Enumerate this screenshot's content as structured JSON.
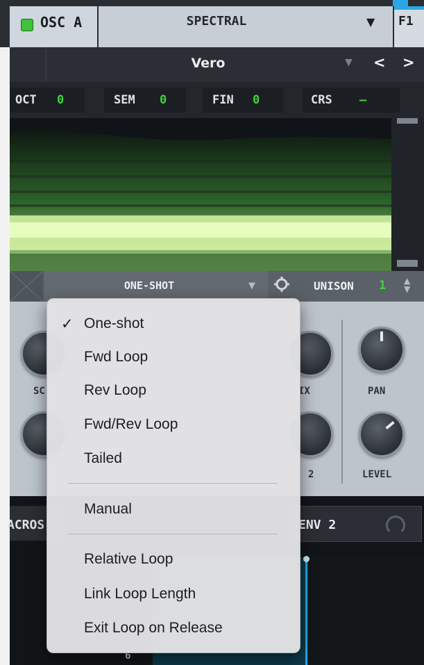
{
  "header": {
    "osc_label": "OSC A",
    "mode_value": "SPECTRAL",
    "mode_arrow": "▼",
    "filter_tab": "F1"
  },
  "wavetable": {
    "name": "Vero",
    "dropdown_arrow": "▼",
    "prev": "<",
    "next": ">"
  },
  "tuning": [
    {
      "label": "OCT",
      "value": "0"
    },
    {
      "label": "SEM",
      "value": "0"
    },
    {
      "label": "FIN",
      "value": "0"
    },
    {
      "label": "CRS",
      "value": "–"
    }
  ],
  "loop_mode": {
    "value": "ONE-SHOT",
    "arrow": "▼"
  },
  "unison": {
    "label": "UNISON",
    "value": "1",
    "stepper": "▲▼"
  },
  "knobs": {
    "sc_label": "SC",
    "ix_label": "IX",
    "pan_label": "PAN",
    "v2_label": "2",
    "level_label": "LEVEL"
  },
  "lower": {
    "macro_label": "ACROS",
    "env_label": "ENV 2",
    "env_marker": "6"
  },
  "menu": {
    "check": "✓",
    "items": [
      "One-shot",
      "Fwd Loop",
      "Rev Loop",
      "Fwd/Rev Loop",
      "Tailed",
      "Manual",
      "Relative Loop",
      "Link Loop Length",
      "Exit Loop on Release"
    ],
    "selected_index": 0
  },
  "colors": {
    "accent_green": "#3fd43a",
    "accent_blue": "#2aa7e6"
  }
}
